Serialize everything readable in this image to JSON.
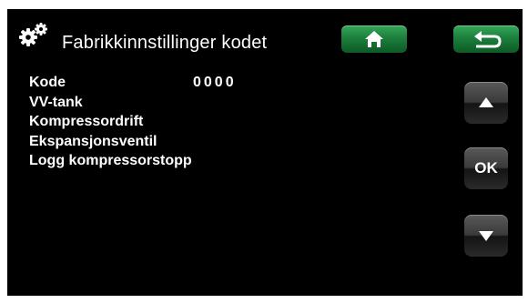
{
  "header": {
    "title": "Fabrikkinnstillinger kodet",
    "settings_icon": "gears-icon",
    "home_icon": "home-icon",
    "back_icon": "back-arrow-icon"
  },
  "menu": {
    "items": [
      {
        "label": "Kode",
        "value": "0000"
      },
      {
        "label": "VV-tank"
      },
      {
        "label": "Kompressordrift"
      },
      {
        "label": "Ekspansjonsventil"
      },
      {
        "label": "Logg kompressorstopp"
      }
    ]
  },
  "nav": {
    "up_icon": "arrow-up-icon",
    "ok_label": "OK",
    "down_icon": "arrow-down-icon"
  },
  "colors": {
    "background": "#000000",
    "text": "#ffffff",
    "accent_green": "#1d7f3c"
  }
}
